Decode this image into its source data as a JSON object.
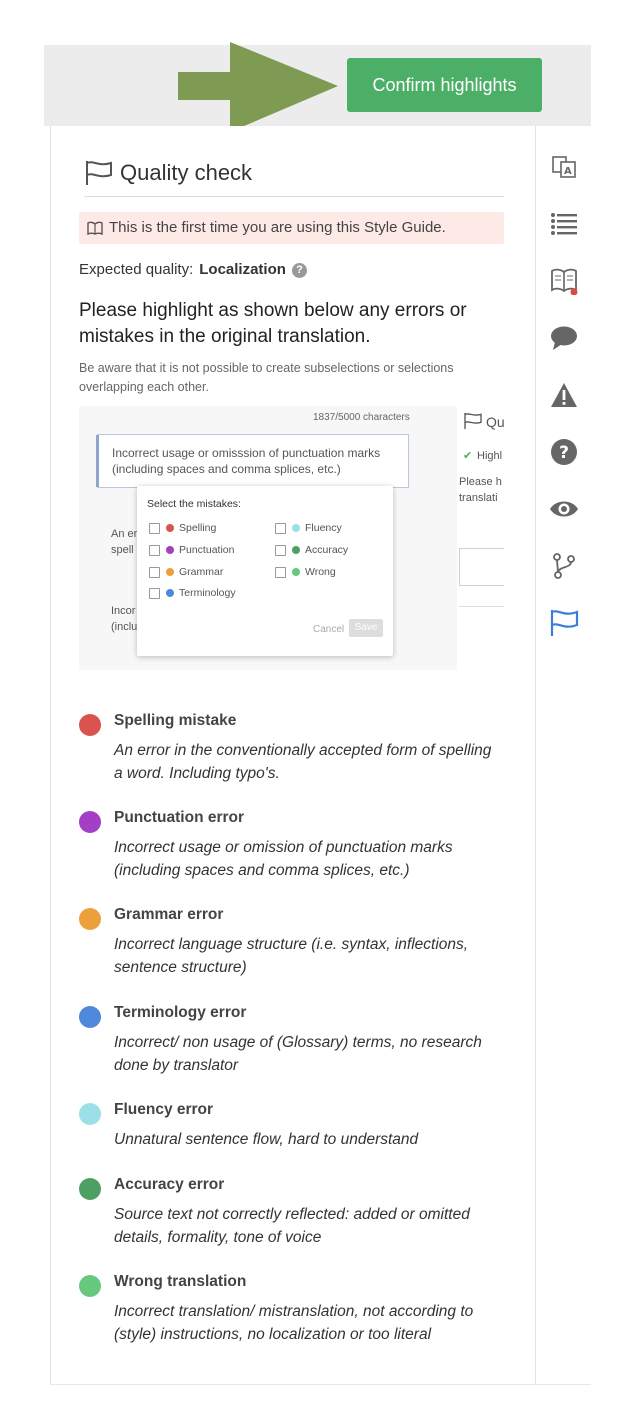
{
  "header": {
    "confirm_label": "Confirm highlights"
  },
  "panel": {
    "title": "Quality check",
    "notice": "This is the first time you are using this Style Guide.",
    "expected_label": "Expected quality:",
    "expected_value": "Localization",
    "instruction": "Please highlight as shown below any errors or mistakes in the original translation.",
    "note": "Be aware that it is not possible to create subselections or selections overlapping each other."
  },
  "example": {
    "char_count": "1837/5000 characters",
    "editor_line1": "Incorrect usage or omisssion of punctuation marks",
    "editor_line2": "(including spaces and comma splices, etc.)",
    "popup_title": "Select the mistakes:",
    "options_left": [
      "Spelling",
      "Punctuation",
      "Grammar",
      "Terminology"
    ],
    "options_right": [
      "Fluency",
      "Accuracy",
      "Wrong"
    ],
    "cancel": "Cancel",
    "save": "Save",
    "bg_text1": "An er",
    "bg_text2": "spell",
    "bg_text3": "Incor",
    "bg_text4": "(inclu",
    "side_title": "Qu",
    "side_check": "Highl",
    "side_p1": "Please h",
    "side_p2": "translati"
  },
  "legend": [
    {
      "title": "Spelling mistake",
      "desc": "An error in the conventionally accepted form of spelling a word. Including typo's.",
      "color": "#d9534f"
    },
    {
      "title": "Punctuation error",
      "desc": "Incorrect usage or omission of punctuation marks (including spaces and comma splices, etc.)",
      "color": "#a33fc4"
    },
    {
      "title": "Grammar error",
      "desc": "Incorrect language structure (i.e. syntax, inflections, sentence structure)",
      "color": "#eca03c"
    },
    {
      "title": "Terminology error",
      "desc": "Incorrect/ non usage of (Glossary) terms, no research done by translator",
      "color": "#4f88dd"
    },
    {
      "title": "Fluency error",
      "desc": "Unnatural sentence flow, hard to understand",
      "color": "#9be0e6"
    },
    {
      "title": "Accuracy error",
      "desc": "Source text not correctly reflected: added or omitted details, formality, tone of voice",
      "color": "#4e9f63"
    },
    {
      "title": "Wrong translation",
      "desc": "Incorrect translation/ mistranslation, not according to (style) instructions, no localization or too literal",
      "color": "#67c97f"
    }
  ],
  "colors": {
    "accent_green": "#4caf67",
    "arrow": "#7f9a52",
    "rail_icon": "#666666",
    "active_icon": "#3b7dd8"
  }
}
